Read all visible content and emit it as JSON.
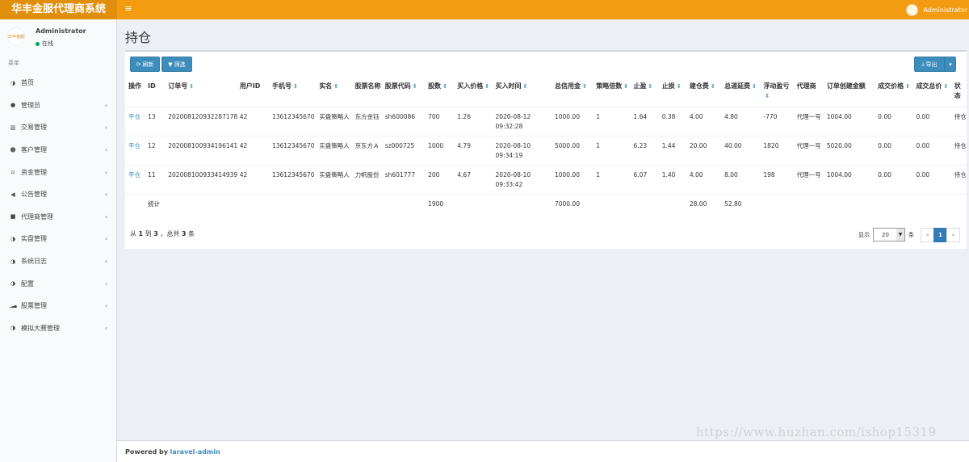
{
  "app": {
    "title": "华丰金服代理商系统",
    "menu_toggle": "≡",
    "top_user": "Administrator"
  },
  "sidebar": {
    "user_name": "Administrator",
    "user_status": "在线",
    "logo_text": "华丰金服",
    "menu_header": "菜单",
    "items": [
      {
        "label": "首页",
        "icon": "◑",
        "icon_name": "home-icon",
        "has_children": false
      },
      {
        "label": "管理员",
        "icon": "●",
        "icon_name": "admin-icon",
        "has_children": true
      },
      {
        "label": "交易管理",
        "icon": "▥",
        "icon_name": "bar-chart-icon",
        "has_children": true
      },
      {
        "label": "客户管理",
        "icon": "☻",
        "icon_name": "users-icon",
        "has_children": true
      },
      {
        "label": "资金管理",
        "icon": "⌂",
        "icon_name": "bank-icon",
        "has_children": true
      },
      {
        "label": "公告管理",
        "icon": "◀",
        "icon_name": "bullhorn-icon",
        "has_children": true
      },
      {
        "label": "代理商管理",
        "icon": "■",
        "icon_name": "lock-icon",
        "has_children": true
      },
      {
        "label": "实盘管理",
        "icon": "◑",
        "icon_name": "half-circle-icon",
        "has_children": true
      },
      {
        "label": "系统日志",
        "icon": "◑",
        "icon_name": "log-icon",
        "has_children": true
      },
      {
        "label": "配置",
        "icon": "◑",
        "icon_name": "config-icon",
        "has_children": true
      },
      {
        "label": "股票管理",
        "icon": "▁▃▅",
        "icon_name": "signal-icon",
        "has_children": true
      },
      {
        "label": "模拟大赛管理",
        "icon": "◑",
        "icon_name": "contest-icon",
        "has_children": true
      }
    ]
  },
  "page": {
    "title": "持仓"
  },
  "toolbar": {
    "refresh": "刷新",
    "filter": "筛选",
    "export": "导出"
  },
  "table": {
    "columns": [
      "操作",
      "ID",
      "订单号",
      "用户ID",
      "手机号",
      "实名",
      "股票名称",
      "股票代码",
      "股数",
      "买入价格",
      "买入时间",
      "总信用金",
      "策略倍数",
      "止盈",
      "止损",
      "建仓费",
      "总递延费",
      "浮动盈亏",
      "代理商",
      "订单创建金额",
      "成交价格",
      "成交总价",
      "状态"
    ],
    "sortable": [
      false,
      false,
      true,
      false,
      true,
      true,
      false,
      true,
      true,
      true,
      true,
      true,
      true,
      true,
      true,
      true,
      true,
      true,
      false,
      false,
      true,
      true,
      false
    ],
    "rows": [
      [
        "平仓",
        "13",
        "202008120932287178",
        "42",
        "13612345670",
        "实盘策略人",
        "东方金钰",
        "sh600086",
        "700",
        "1.26",
        "2020-08-12 09:32:28",
        "1000.00",
        "1",
        "1.64",
        "0.38",
        "4.00",
        "4.80",
        "-770",
        "代理一号",
        "1004.00",
        "0.00",
        "0.00",
        "持仓"
      ],
      [
        "平仓",
        "12",
        "202008100934196141",
        "42",
        "13612345670",
        "实盘策略人",
        "京东方Ａ",
        "sz000725",
        "1000",
        "4.79",
        "2020-08-10 09:34:19",
        "5000.00",
        "1",
        "6.23",
        "1.44",
        "20.00",
        "40.00",
        "1820",
        "代理一号",
        "5020.00",
        "0.00",
        "0.00",
        "持仓"
      ],
      [
        "平仓",
        "11",
        "202008100933414939",
        "42",
        "13612345670",
        "实盘策略人",
        "力帆股份",
        "sh601777",
        "200",
        "4.67",
        "2020-08-10 09:33:42",
        "1000.00",
        "1",
        "6.07",
        "1.40",
        "4.00",
        "8.00",
        "198",
        "代理一号",
        "1004.00",
        "0.00",
        "0.00",
        "持仓"
      ]
    ],
    "summary": [
      "",
      "统计",
      "",
      "",
      "",
      "",
      "",
      "",
      "1900",
      "",
      "",
      "7000.00",
      "",
      "",
      "",
      "28.00",
      "52.80",
      "",
      "",
      "",
      "",
      "",
      ""
    ]
  },
  "pager": {
    "from_label": "从",
    "from": "1",
    "to_label": "到",
    "to": "3",
    "total_label": "，总共",
    "total": "3",
    "unit": "条",
    "show_label": "显示",
    "per_page": "20",
    "per_unit": "条",
    "prev": "«",
    "current": "1",
    "next": "»"
  },
  "footer": {
    "powered_by": "Powered by",
    "link": "laravel-admin"
  },
  "watermark": "https://www.huzhan.com/ishop15319",
  "colors": {
    "header": "#f39c12",
    "brand_bg": "#e08e0b",
    "primary": "#3c8dbc",
    "status_online": "#00a65a"
  }
}
